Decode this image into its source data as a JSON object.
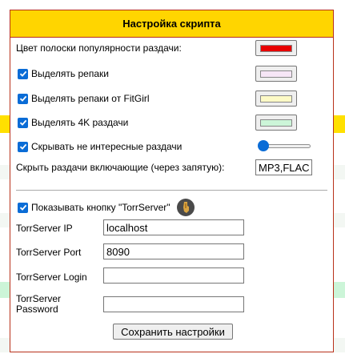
{
  "dialog": {
    "title": "Настройка скрипта",
    "popularity_label": "Цвет полоски популярности раздачи:",
    "options": [
      {
        "label": "Выделять репаки",
        "checked": true,
        "swatch_color": "#f6e6f6"
      },
      {
        "label": "Выделять репаки от FitGirl",
        "checked": true,
        "swatch_color": "#fdfac6"
      },
      {
        "label": "Выделять 4K раздачи",
        "checked": true,
        "swatch_color": "#ccf5d8"
      }
    ],
    "popularity_color": "#e80000",
    "hide_uninteresting": {
      "label": "Скрывать не интересные раздачи",
      "checked": true,
      "slider_value": 0
    },
    "hide_including": {
      "label": "Скрыть раздачи включающие (через запятую):",
      "value": "MP3,FLAC"
    },
    "torrserver_button": {
      "label": "Показывать кнопку \"TorrServer\"",
      "checked": true
    },
    "fields": {
      "ip": {
        "label": "TorrServer IP",
        "value": "localhost"
      },
      "port": {
        "label": "TorrServer Port",
        "value": "8090"
      },
      "login": {
        "label": "TorrServer Login",
        "value": ""
      },
      "password": {
        "label_line1": "TorrServer",
        "label_line2": "Password",
        "value": ""
      }
    },
    "save_label": "Сохранить настройки"
  },
  "colors": {
    "header": "#ffd500",
    "border": "#b8301a",
    "accent": "#0a6cd6"
  },
  "icons": {
    "torrserver": "torrserver-icon",
    "check": "checkmark-icon"
  }
}
